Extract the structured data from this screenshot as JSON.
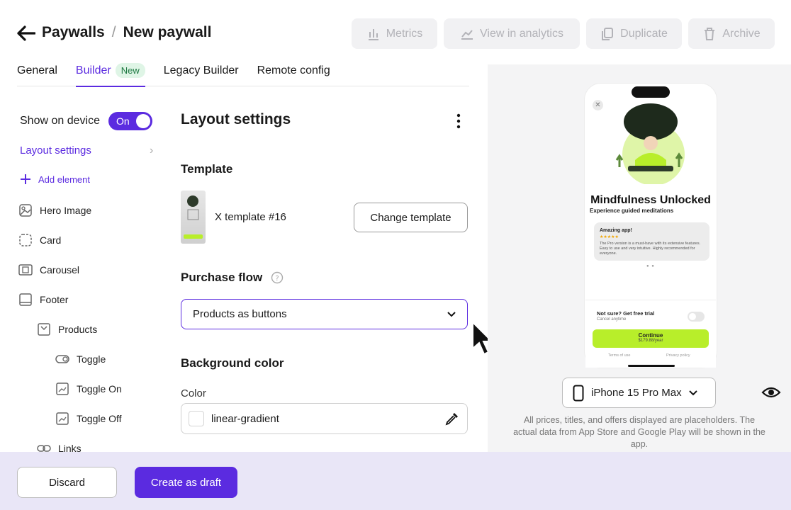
{
  "header": {
    "breadcrumb_root": "Paywalls",
    "breadcrumb_sep": "/",
    "breadcrumb_current": "New paywall",
    "actions": {
      "metrics": "Metrics",
      "analytics": "View in analytics",
      "duplicate": "Duplicate",
      "archive": "Archive"
    }
  },
  "tabs": {
    "general": "General",
    "builder": "Builder",
    "builder_badge": "New",
    "legacy": "Legacy Builder",
    "remote": "Remote config"
  },
  "sidebar": {
    "show_on_device": "Show on device",
    "toggle_state": "On",
    "layout_settings": "Layout settings",
    "add_element": "Add element",
    "items": [
      {
        "label": "Hero Image",
        "icon": "image-icon"
      },
      {
        "label": "Card",
        "icon": "dashed-square-icon"
      },
      {
        "label": "Carousel",
        "icon": "carousel-icon"
      },
      {
        "label": "Footer",
        "icon": "footer-icon"
      },
      {
        "label": "Products",
        "icon": "products-icon"
      },
      {
        "label": "Toggle",
        "icon": "toggle-icon"
      },
      {
        "label": "Toggle On",
        "icon": "toggle-on-icon"
      },
      {
        "label": "Toggle Off",
        "icon": "toggle-off-icon"
      },
      {
        "label": "Links",
        "icon": "link-icon"
      }
    ]
  },
  "main": {
    "title": "Layout settings",
    "template_heading": "Template",
    "template_name": "X template #16",
    "change_template": "Change template",
    "purchase_flow_heading": "Purchase flow",
    "purchase_flow_value": "Products as buttons",
    "bg_heading": "Background color",
    "color_label": "Color",
    "color_value": "linear-gradient"
  },
  "preview": {
    "app_title": "Mindfulness Unlocked",
    "app_subtitle": "Experience guided meditations",
    "review_title": "Amazing app!",
    "review_stars": "★★★★★",
    "review_text": "The Pro version is a must-have with its extensive features. Easy to use and very intuitive. Highly recommended for everyone.",
    "trial_title": "Not sure? Get free trial",
    "trial_sub": "Cancel anytime",
    "continue": "Continue",
    "price": "$179.88/year",
    "terms": "Terms of use",
    "privacy": "Privacy policy",
    "device": "iPhone 15 Pro Max",
    "disclaimer": "All prices, titles, and offers displayed are placeholders. The actual data from App Store and Google Play will be shown in the app."
  },
  "footer": {
    "discard": "Discard",
    "create_draft": "Create as draft"
  },
  "colors": {
    "accent": "#5b2be0",
    "lime": "#b8ee2a"
  }
}
